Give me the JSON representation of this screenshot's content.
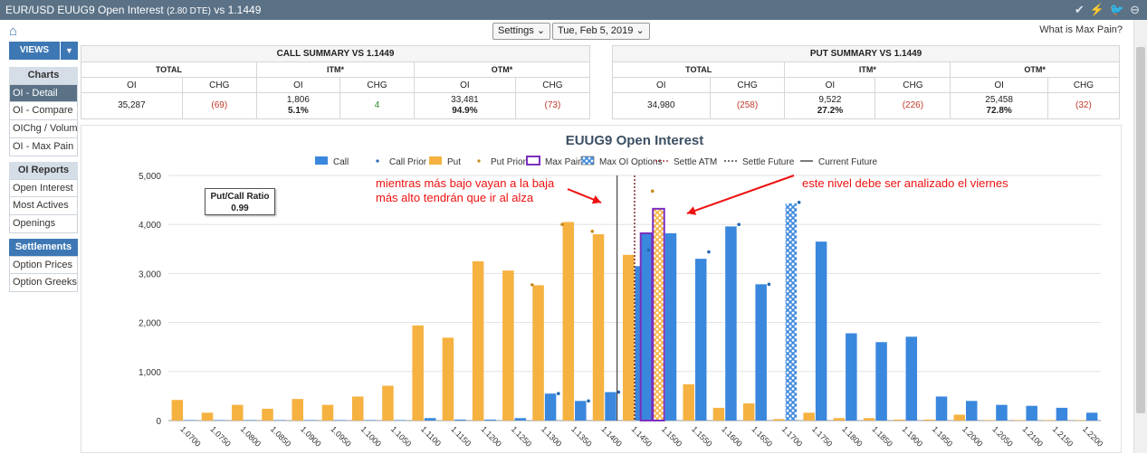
{
  "title": {
    "main": "EUR/USD EUUG9 Open Interest",
    "sub": "(2.80 DTE)",
    "vs": "vs  1.1449"
  },
  "topbar": {
    "settings": "Settings",
    "date": "Tue, Feb 5, 2019",
    "max_pain_link": "What is Max Pain?"
  },
  "sidebar": {
    "views": "VIEWS",
    "groups": [
      {
        "head": "Charts",
        "blue": false,
        "items": [
          "OI - Detail",
          "OI - Compare",
          "OIChg / Volume",
          "OI - Max Pain"
        ],
        "active": 0
      },
      {
        "head": "OI Reports",
        "blue": false,
        "items": [
          "Open Interest",
          "Most Actives",
          "Openings"
        ],
        "active": -1
      },
      {
        "head": "Settlements",
        "blue": true,
        "items": [
          "Option Prices",
          "Option Greeks"
        ],
        "active": -1
      }
    ]
  },
  "call_summary": {
    "caption": "CALL SUMMARY VS 1.1449",
    "groups": [
      "TOTAL",
      "ITM*",
      "OTM*"
    ],
    "cols": [
      "OI",
      "CHG",
      "OI",
      "CHG",
      "OI",
      "CHG"
    ],
    "values": [
      {
        "v": "35,287",
        "pct": "",
        "cls": ""
      },
      {
        "v": "(69)",
        "pct": "",
        "cls": "neg"
      },
      {
        "v": "1,806",
        "pct": "5.1%",
        "cls": ""
      },
      {
        "v": "4",
        "pct": "",
        "cls": "pos"
      },
      {
        "v": "33,481",
        "pct": "94.9%",
        "cls": ""
      },
      {
        "v": "(73)",
        "pct": "",
        "cls": "neg"
      }
    ]
  },
  "put_summary": {
    "caption": "PUT SUMMARY VS 1.1449",
    "groups": [
      "TOTAL",
      "ITM*",
      "OTM*"
    ],
    "cols": [
      "OI",
      "CHG",
      "OI",
      "CHG",
      "OI",
      "CHG"
    ],
    "values": [
      {
        "v": "34,980",
        "pct": "",
        "cls": ""
      },
      {
        "v": "(258)",
        "pct": "",
        "cls": "neg"
      },
      {
        "v": "9,522",
        "pct": "27.2%",
        "cls": ""
      },
      {
        "v": "(226)",
        "pct": "",
        "cls": "neg"
      },
      {
        "v": "25,458",
        "pct": "72.8%",
        "cls": ""
      },
      {
        "v": "(32)",
        "pct": "",
        "cls": "neg"
      }
    ]
  },
  "put_call_ratio": {
    "label": "Put/Call Ratio",
    "value": "0.99"
  },
  "annotations": {
    "left": [
      "mientras más bajo vayan a la baja",
      "más alto tendrán que ir al alza"
    ],
    "right": "este nivel debe ser analizado el viernes"
  },
  "colors": {
    "call": "#3a87de",
    "put": "#f5b240",
    "max_pain": "#7b2fbf",
    "annotation": "#ee1111"
  },
  "chart_data": {
    "type": "bar",
    "title": "EUUG9 Open Interest",
    "legend": [
      "Call",
      "Call Prior",
      "Put",
      "Put Prior",
      "Max Pain",
      "Max OI Options",
      "Settle ATM",
      "Settle Future",
      "Current Future"
    ],
    "legend_position": "top",
    "categories": [
      "1.0700",
      "1.0750",
      "1.0800",
      "1.0850",
      "1.0900",
      "1.0950",
      "1.1000",
      "1.1050",
      "1.1100",
      "1.1150",
      "1.1200",
      "1.1250",
      "1.1300",
      "1.1350",
      "1.1400",
      "1.1450",
      "1.1500",
      "1.1550",
      "1.1600",
      "1.1650",
      "1.1700",
      "1.1750",
      "1.1800",
      "1.1850",
      "1.1900",
      "1.1950",
      "1.2000",
      "1.2050",
      "1.2100",
      "1.2150",
      "1.2200"
    ],
    "series": [
      {
        "name": "Call",
        "values": [
          10,
          10,
          10,
          10,
          10,
          10,
          10,
          10,
          50,
          20,
          20,
          50,
          550,
          400,
          580,
          3150,
          3820,
          3300,
          3960,
          2780,
          4430,
          3650,
          1780,
          1600,
          1710,
          490,
          400,
          320,
          300,
          260,
          160
        ]
      },
      {
        "name": "Put",
        "values": [
          420,
          160,
          320,
          240,
          440,
          320,
          490,
          710,
          1940,
          1690,
          3250,
          3060,
          2760,
          4050,
          3800,
          3380,
          4320,
          740,
          260,
          350,
          30,
          160,
          50,
          50,
          20,
          20,
          120,
          10,
          10,
          10,
          10
        ]
      }
    ],
    "call_prior": {
      "1.1300": 550,
      "1.1350": 400,
      "1.1400": 580,
      "1.1450": 3480,
      "1.1550": 3440,
      "1.1600": 4000,
      "1.1650": 2780,
      "1.1700": 4450
    },
    "put_prior": {
      "1.1300": 2770,
      "1.1350": 4000,
      "1.1400": 3860,
      "1.1500": 4680
    },
    "max_pain": "1.1500",
    "max_oi_call": "1.1700",
    "max_oi_put": "1.1500",
    "settle_future": 1.1459,
    "current_future": 1.1442,
    "ylim": [
      0,
      5000
    ],
    "yticks": [
      "0",
      "1,000",
      "2,000",
      "3,000",
      "4,000",
      "5,000"
    ],
    "grid": true
  }
}
